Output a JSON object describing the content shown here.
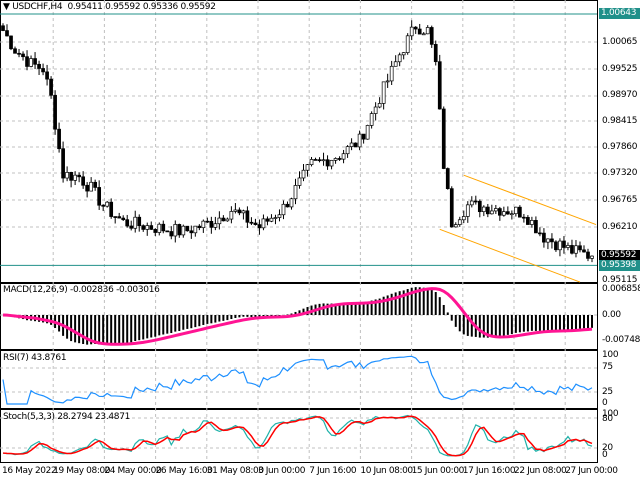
{
  "header": {
    "symbol": "USDCHF,H4",
    "open": "0.95411",
    "high": "0.95592",
    "low": "0.95336",
    "close": "0.95592"
  },
  "price_axis": [
    "1.00065",
    "0.99525",
    "0.98970",
    "0.98415",
    "0.97860",
    "0.97320",
    "0.96765",
    "0.96210",
    "0.95115"
  ],
  "price_tags": {
    "top_line": "1.00643",
    "bid": "0.95592",
    "support_line": "0.95398"
  },
  "macd": {
    "label": "MACD(12,26,9) -0.002836 -0.003016",
    "axis": [
      "0.006858",
      "0.00",
      "-0.007487"
    ]
  },
  "rsi": {
    "label": "RSI(7) 43.8761",
    "axis": [
      "100",
      "75",
      "25",
      "0"
    ]
  },
  "stoch": {
    "label": "Stoch(5,3,3) 28.2794 23.4871",
    "axis": [
      "100",
      "80",
      "20",
      "0"
    ]
  },
  "time_axis": [
    "16 May 2022",
    "19 May 08:00",
    "24 May 00:00",
    "26 May 16:00",
    "31 May 08:00",
    "3 Jun 00:00",
    "7 Jun 16:00",
    "10 Jun 08:00",
    "15 Jun 00:00",
    "17 Jun 16:00",
    "22 Jun 08:00",
    "27 Jun 00:00"
  ],
  "colors": {
    "teal": "#20908a",
    "macd_signal": "#ff1493",
    "rsi": "#1e90ff",
    "stoch_main": "#20b2aa",
    "stoch_signal": "#ff0000",
    "channel": "#ffa500"
  },
  "chart_data": {
    "type": "candlestick",
    "title": "USDCHF,H4",
    "bars": 148,
    "price_keypoints": [
      [
        0,
        1.003
      ],
      [
        3,
        0.999
      ],
      [
        7,
        0.996
      ],
      [
        10,
        0.995
      ],
      [
        12,
        0.989
      ],
      [
        15,
        0.973
      ],
      [
        19,
        0.9725
      ],
      [
        22,
        0.97
      ],
      [
        25,
        0.9665
      ],
      [
        30,
        0.963
      ],
      [
        37,
        0.962
      ],
      [
        45,
        0.961
      ],
      [
        52,
        0.963
      ],
      [
        57,
        0.9655
      ],
      [
        64,
        0.962
      ],
      [
        70,
        0.966
      ],
      [
        77,
        0.975
      ],
      [
        84,
        0.977
      ],
      [
        89,
        0.98
      ],
      [
        94,
        0.989
      ],
      [
        99,
        0.998
      ],
      [
        103,
        1.004
      ],
      [
        106,
        1.003
      ],
      [
        108,
        0.996
      ],
      [
        110,
        0.975
      ],
      [
        112,
        0.963
      ],
      [
        116,
        0.9665
      ],
      [
        122,
        0.966
      ],
      [
        130,
        0.965
      ],
      [
        135,
        0.96
      ],
      [
        142,
        0.957
      ],
      [
        147,
        0.95592
      ]
    ],
    "ylim": [
      0.9506,
      1.0075
    ],
    "horizontal_levels": [
      1.00643,
      0.95398
    ],
    "channel": {
      "upper": [
        [
          115,
          0.9728
        ],
        [
          148,
          0.9625
        ]
      ],
      "lower": [
        [
          109,
          0.9615
        ],
        [
          144,
          0.9505
        ]
      ]
    }
  }
}
